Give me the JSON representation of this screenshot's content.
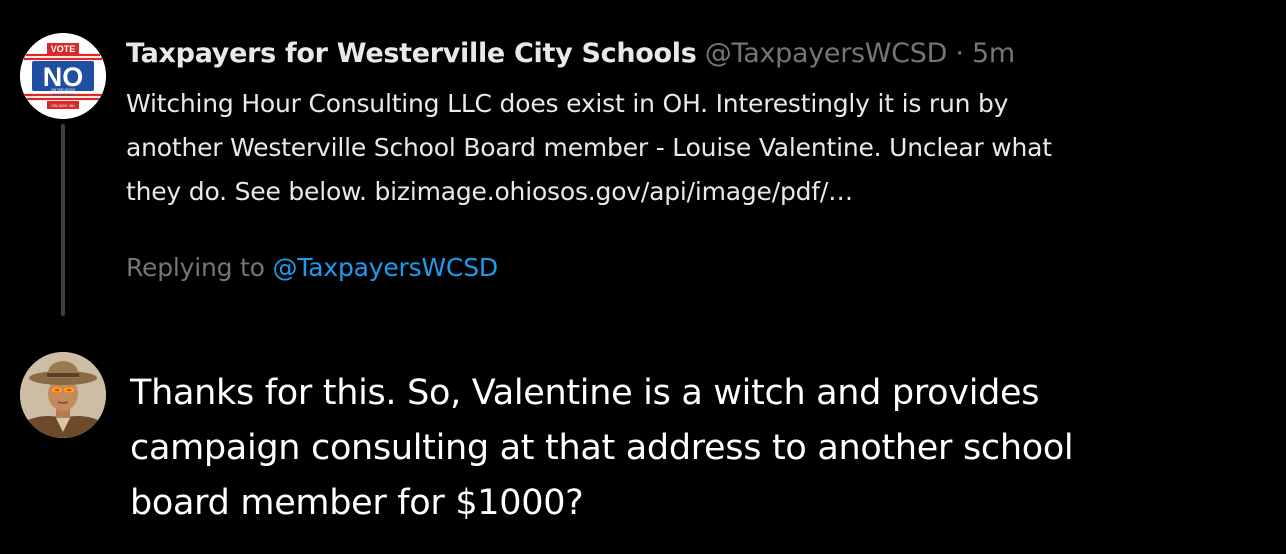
{
  "tweet": {
    "avatar_text_top": "VOTE",
    "avatar_text_main": "NO",
    "avatar_text_small1": "ON THE WCSD",
    "avatar_text_small2": "INCOME TAX",
    "avatar_text_bottom": "ON NOV. 4th",
    "author_name": "Taxpayers for Westerville City Schools",
    "author_handle": "@TaxpayersWCSD",
    "separator": "·",
    "time": "5m",
    "body": "Witching Hour Consulting LLC does exist in OH. Interestingly it is run by\nanother Westerville School Board member - Louise Valentine. Unclear what\nthey do. See below. bizimage.ohiosos.gov/api/image/pdf/…"
  },
  "reply_context": {
    "prefix": "Replying to",
    "handle": "@TaxpayersWCSD"
  },
  "reply": {
    "text": "Thanks for this.  So, Valentine is a witch and provides\ncampaign consulting at that address to another school\nboard member for $1000?"
  },
  "colors": {
    "background": "#000000",
    "primary_text": "#e7e9ea",
    "secondary_text": "#71767b",
    "link": "#1d9bf0",
    "thread_line": "#3e4144",
    "badge_red": "#d62b2b",
    "badge_blue": "#1f4fa3"
  },
  "icons": {
    "avatar1": "vote-no-badge-avatar",
    "avatar2": "cowboy-avatar"
  }
}
